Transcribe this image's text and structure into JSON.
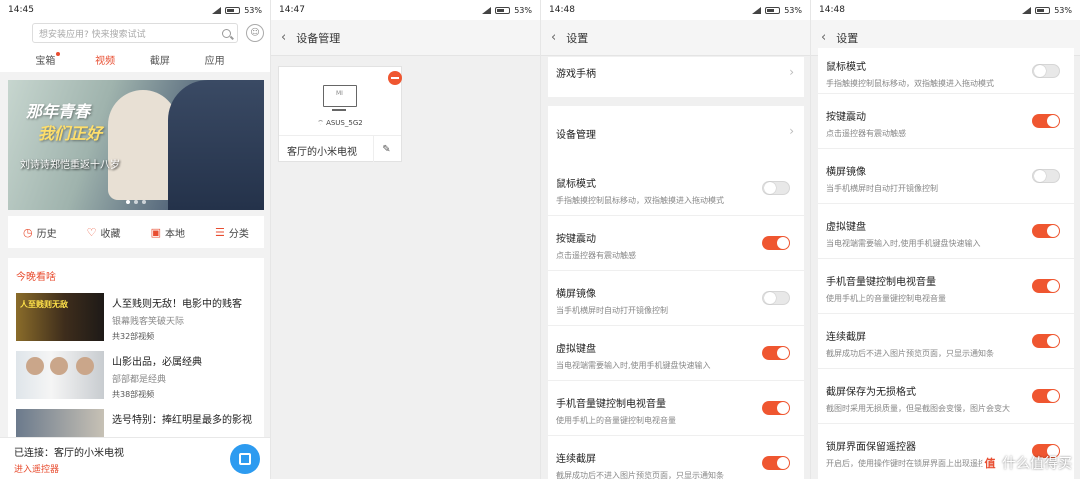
{
  "panel1": {
    "status": {
      "time": "14:45",
      "battery": "53%"
    },
    "search_placeholder": "想安装应用? 快来搜索试试",
    "tabs": [
      {
        "label": "宝箱",
        "badge": true
      },
      {
        "label": "视频"
      },
      {
        "label": "截屏"
      },
      {
        "label": "应用"
      }
    ],
    "banner": {
      "title_line1": "那年青春",
      "title_line2": "我们正好",
      "caption": "刘诗诗郑恺重返十八岁"
    },
    "quick": [
      "历史",
      "收藏",
      "本地",
      "分类"
    ],
    "tonight_title": "今晚看啥",
    "list": [
      {
        "title": "人至贱则无敌！电影中的贱客",
        "subtitle": "银幕贱客笑破天际",
        "count": "共32部视频",
        "thumb_text": "人至贱则无敌"
      },
      {
        "title": "山影出品，必属经典",
        "subtitle": "部部都是经典",
        "count": "共38部视频"
      },
      {
        "title": "选号特别：捧红明星最多的影视",
        "subtitle": "",
        "count": ""
      }
    ],
    "connected": "已连接：客厅的小米电视",
    "enter_remote": "进入遥控器"
  },
  "panel2": {
    "status": {
      "time": "14:47",
      "battery": "53%"
    },
    "title": "设备管理",
    "device": {
      "brand": "MI",
      "wifi": "ASUS_5G2",
      "name": "客厅的小米电视"
    }
  },
  "panel3": {
    "status": {
      "time": "14:48",
      "battery": "53%"
    },
    "title": "设置",
    "top_item": "游戏手柄",
    "device_mgmt": "设备管理",
    "items": [
      {
        "title": "鼠标模式",
        "desc": "手指触摸控制鼠标移动，双指触摸进入拖动模式",
        "on": false
      },
      {
        "title": "按键震动",
        "desc": "点击遥控器有震动触感",
        "on": true
      },
      {
        "title": "横屏镜像",
        "desc": "当手机横屏时自动打开镜像控制",
        "on": false
      },
      {
        "title": "虚拟键盘",
        "desc": "当电视端需要输入时,使用手机键盘快速输入",
        "on": true
      },
      {
        "title": "手机音量键控制电视音量",
        "desc": "使用手机上的音量键控制电视音量",
        "on": true
      },
      {
        "title": "连续截屏",
        "desc": "截屏成功后不进入图片预览页面，只显示通知条",
        "on": true
      }
    ]
  },
  "panel4": {
    "status": {
      "time": "14:48",
      "battery": "53%"
    },
    "title": "设置",
    "items": [
      {
        "title": "鼠标模式",
        "desc": "手指触摸控制鼠标移动，双指触摸进入拖动模式",
        "on": false
      },
      {
        "title": "按键震动",
        "desc": "点击遥控器有震动触感",
        "on": true
      },
      {
        "title": "横屏镜像",
        "desc": "当手机横屏时自动打开镜像控制",
        "on": false
      },
      {
        "title": "虚拟键盘",
        "desc": "当电视端需要输入时,使用手机键盘快速输入",
        "on": true
      },
      {
        "title": "手机音量键控制电视音量",
        "desc": "使用手机上的音量键控制电视音量",
        "on": true
      },
      {
        "title": "连续截屏",
        "desc": "截屏成功后不进入图片预览页面，只显示通知条",
        "on": true
      },
      {
        "title": "截屏保存为无损格式",
        "desc": "截图时采用无损质量，但是截图会变慢，图片会变大",
        "on": true
      },
      {
        "title": "锁屏界面保留遥控器",
        "desc": "开启后，使用操作键时在锁屏界面上出现遥控器",
        "on": true
      }
    ],
    "watermark": "什么值得买"
  },
  "colors": {
    "accent": "#e84d30",
    "toggle_on": "#ef5630",
    "fab": "#2d9bf0"
  }
}
